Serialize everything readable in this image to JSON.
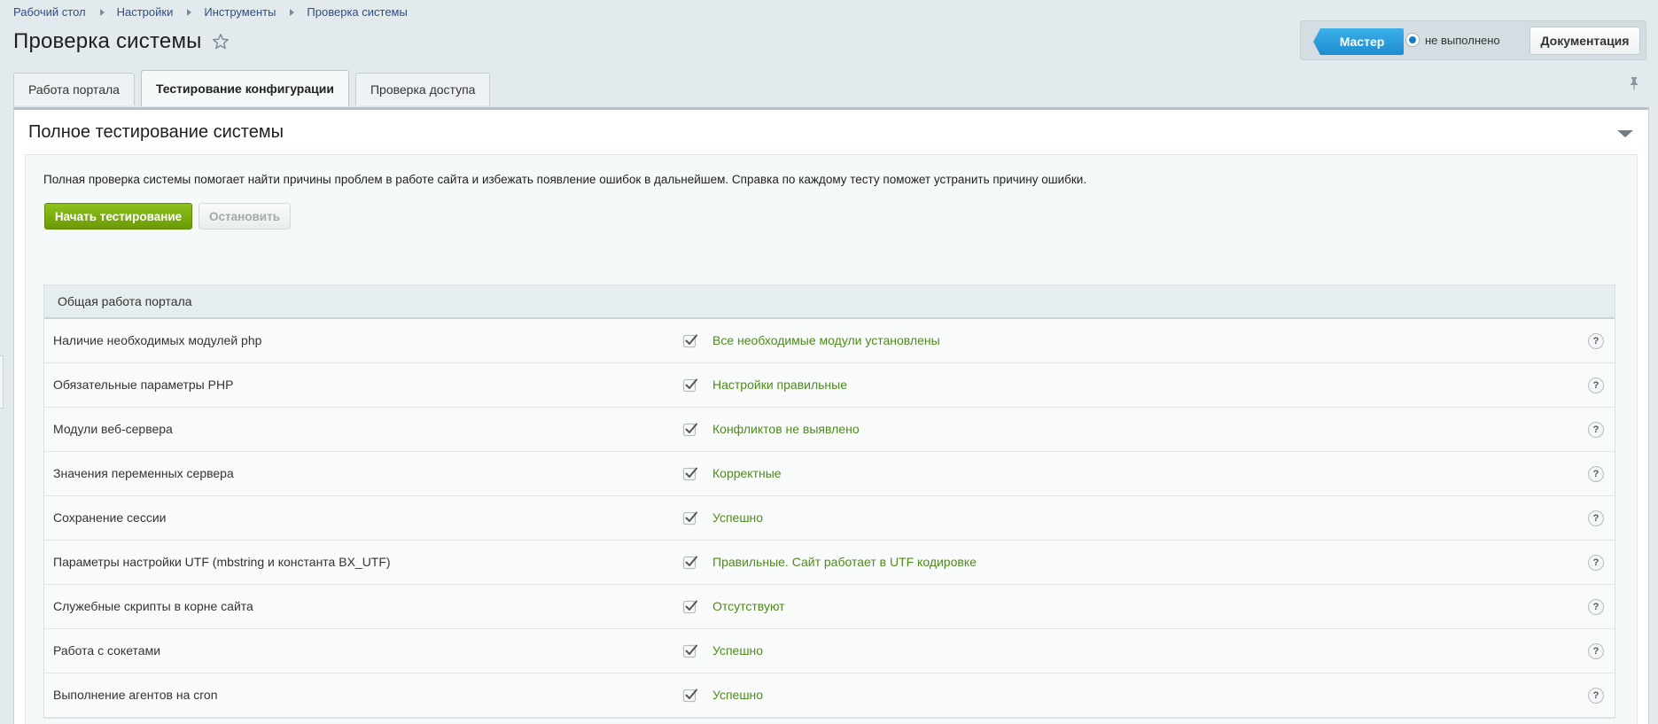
{
  "breadcrumb": [
    "Рабочий стол",
    "Настройки",
    "Инструменты",
    "Проверка системы"
  ],
  "page_title": "Проверка системы",
  "wizard": {
    "master_label": "Мастер",
    "status_text": "не выполнено",
    "documentation_label": "Документация"
  },
  "tabs": [
    {
      "label": "Работа портала",
      "active": false
    },
    {
      "label": "Тестирование конфигурации",
      "active": true
    },
    {
      "label": "Проверка доступа",
      "active": false
    }
  ],
  "section": {
    "title": "Полное тестирование системы",
    "description": "Полная проверка системы помогает найти причины проблем в работе сайта и избежать появление ошибок в дальнейшем. Справка по каждому тесту поможет устранить причину ошибки.",
    "start_label": "Начать тестирование",
    "stop_label": "Остановить"
  },
  "table": {
    "group_title": "Общая работа портала",
    "rows": [
      {
        "name": "Наличие необходимых модулей php",
        "result": "Все необходимые модули установлены"
      },
      {
        "name": "Обязательные параметры PHP",
        "result": "Настройки правильные"
      },
      {
        "name": "Модули веб-сервера",
        "result": "Конфликтов не выявлено"
      },
      {
        "name": "Значения переменных сервера",
        "result": "Корректные"
      },
      {
        "name": "Сохранение сессии",
        "result": "Успешно"
      },
      {
        "name": "Параметры настройки UTF (mbstring и константа BX_UTF)",
        "result": "Правильные. Сайт работает в UTF кодировке"
      },
      {
        "name": "Служебные скрипты в корне сайта",
        "result": "Отсутствуют"
      },
      {
        "name": "Работа с сокетами",
        "result": "Успешно"
      },
      {
        "name": "Выполнение агентов на cron",
        "result": "Успешно"
      }
    ],
    "help_symbol": "?"
  },
  "colors": {
    "master_blue": "#1c8ccf",
    "start_green": "#6a9a06",
    "result_green": "#4e8a1c",
    "link_blue": "#2e4e84"
  },
  "icons": [
    "star-icon",
    "pin-icon",
    "chevron-down-icon",
    "check-icon",
    "help-icon"
  ]
}
